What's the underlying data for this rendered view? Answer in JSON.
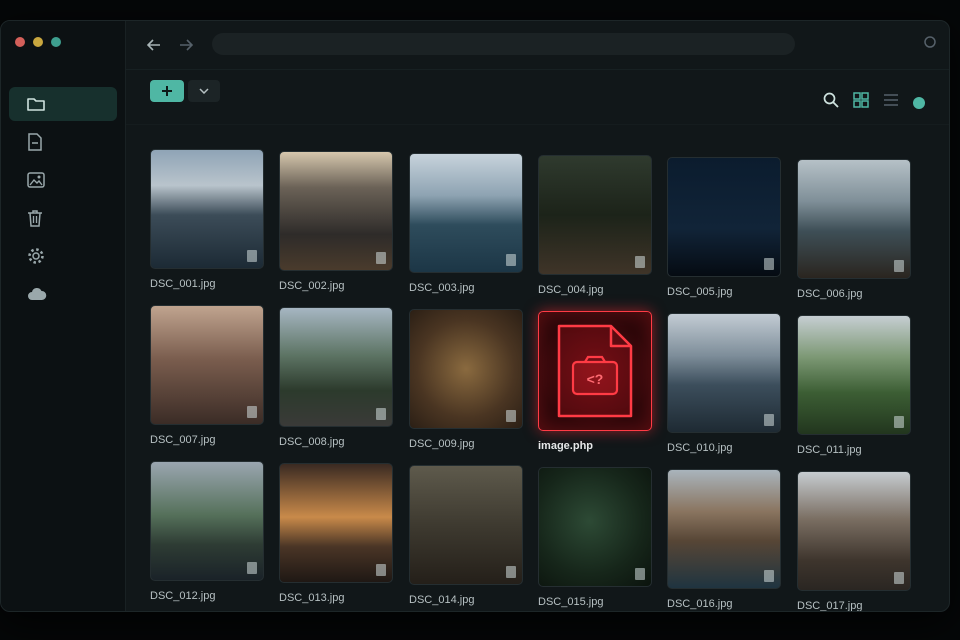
{
  "files": [
    {
      "name": "DSC_001.jpg",
      "bg": "linear-gradient(180deg,#8fa4b6 0%,#b9c4cc 30%,#3c4c58 55%,#1c2a35 100%)"
    },
    {
      "name": "DSC_002.jpg",
      "bg": "linear-gradient(180deg,#d6c7ad 0%,#6b6257 30%,#2e2b29 70%,#4a3b2c 100%)"
    },
    {
      "name": "DSC_003.jpg",
      "bg": "linear-gradient(180deg,#c7d3dc 0%,#8ea3b2 35%,#2e4c5c 60%,#1c3646 100%)"
    },
    {
      "name": "DSC_004.jpg",
      "bg": "linear-gradient(180deg,#2f3a2e 0%,#1c2319 50%,#3f3428 100%)"
    },
    {
      "name": "DSC_005.jpg",
      "bg": "linear-gradient(180deg,#0b1c2e 0%,#112438 60%,#050b12 100%)"
    },
    {
      "name": "DSC_006.jpg",
      "bg": "linear-gradient(180deg,#b6c1c7 0%,#7f8f98 35%,#3e4f57 60%,#2a251f 100%)"
    },
    {
      "name": "DSC_007.jpg",
      "bg": "linear-gradient(180deg,#c0a48f 0%,#7a5d4e 45%,#3b2c26 100%)"
    },
    {
      "name": "DSC_008.jpg",
      "bg": "linear-gradient(180deg,#a6b6c2 0%,#5d7464 40%,#2c3a2c 70%,#3a3a38 100%)"
    },
    {
      "name": "DSC_009.jpg",
      "bg": "radial-gradient(circle at 50% 50%,#8a6a3f 0%,#4a3522 60%,#2b1f15 100%)"
    },
    {
      "name": "image.php",
      "danger": true
    },
    {
      "name": "DSC_010.jpg",
      "bg": "linear-gradient(180deg,#c3ccd4 0%,#7e8e9a 35%,#3c4e5c 60%,#1e2a33 100%)"
    },
    {
      "name": "DSC_011.jpg",
      "bg": "linear-gradient(180deg,#c6ced2 0%,#7c9874 35%,#3c5e34 65%,#22361e 100%)"
    },
    {
      "name": "DSC_012.jpg",
      "bg": "linear-gradient(180deg,#9aa6b0 0%,#55705a 45%,#2e3c34 70%,#1a2228 100%)"
    },
    {
      "name": "DSC_013.jpg",
      "bg": "linear-gradient(180deg,#3a2a22 0%,#c98a4a 45%,#4a3526 70%,#1f1814 100%)"
    },
    {
      "name": "DSC_014.jpg",
      "bg": "linear-gradient(180deg,#5e5a4c 0%,#3e3a30 50%,#241f19 100%)"
    },
    {
      "name": "DSC_015.jpg",
      "bg": "radial-gradient(circle at 45% 45%,#2d4a35 0%,#16261a 60%,#0b130d 100%)"
    },
    {
      "name": "DSC_016.jpg",
      "bg": "linear-gradient(180deg,#a9b4bc 0%,#8a7560 35%,#574636 60%,#1f3440 100%)"
    },
    {
      "name": "DSC_017.jpg",
      "bg": "linear-gradient(180deg,#c6ccd0 0%,#7a6e62 40%,#3e352d 75%,#2a2622 100%)"
    }
  ],
  "icons": {
    "sidebar": [
      "folder-icon",
      "document-icon",
      "image-icon",
      "trash-icon",
      "gear-icon",
      "cloud-icon"
    ],
    "toolbar": [
      "search-icon",
      "grid-view-icon",
      "list-view-icon"
    ]
  },
  "colors": {
    "accent": "#4fb7a4",
    "danger": "#ff3b45"
  }
}
